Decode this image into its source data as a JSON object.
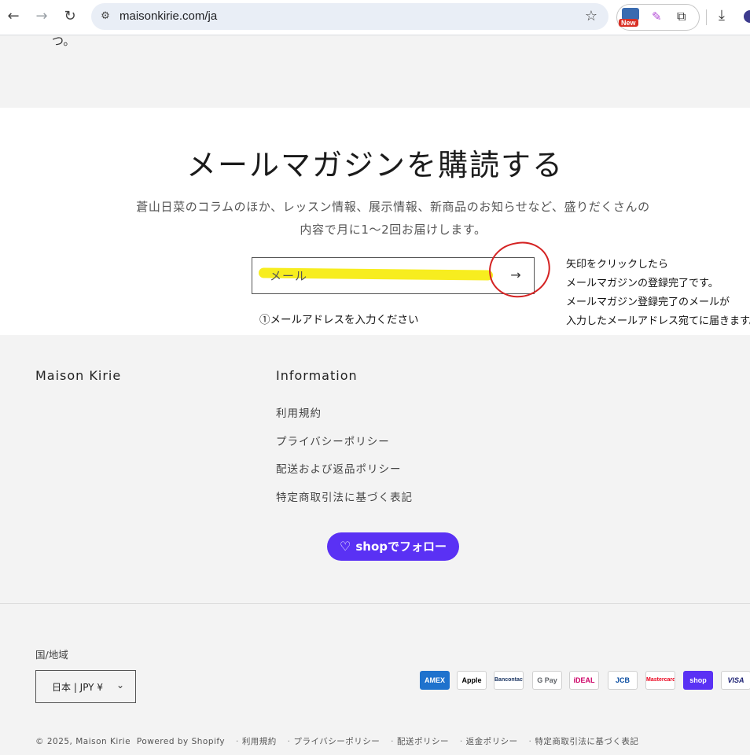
{
  "browser": {
    "url": "maisonkirie.com/ja",
    "ext_badge": "New"
  },
  "top_fragment": "つ。",
  "newsletter": {
    "title": "メールマガジンを購読する",
    "desc_line1": "蒼山日菜のコラムのほか、レッスン情報、展示情報、新商品のお知らせなど、盛りだくさんの",
    "desc_line2": "内容で月に1〜2回お届けします。",
    "email_placeholder": "メール",
    "arrow": "→"
  },
  "annotations": {
    "step1": "①メールアドレスを入力ください",
    "side": [
      "矢印をクリックしたら",
      "メールマガジンの登録完了です。",
      "メールマガジン登録完了のメールが",
      "入力したメールアドレス宛てに届きます。"
    ]
  },
  "footer": {
    "brand": "Maison Kirie",
    "info_title": "Information",
    "info_links": [
      "利用規約",
      "プライバシーポリシー",
      "配送および返品ポリシー",
      "特定商取引法に基づく表記"
    ],
    "shop_follow": "shopでフォロー",
    "region_label": "国/地域",
    "region_value": "日本 | JPY ¥",
    "payments": [
      "AMEX",
      "Apple Pay",
      "Bancontact",
      "G Pay",
      "iDEAL",
      "JCB",
      "Mastercard",
      "shop",
      "VISA"
    ],
    "copyright": "© 2025, Maison Kirie",
    "powered": "Powered by Shopify",
    "policy_links": [
      "利用規約",
      "プライバシーポリシー",
      "配送ポリシー",
      "返金ポリシー",
      "特定商取引法に基づく表記"
    ]
  },
  "colors": {
    "accent_shop": "#5a31f4",
    "highlight": "#f7ec13",
    "annotation_circle": "#d42222"
  }
}
